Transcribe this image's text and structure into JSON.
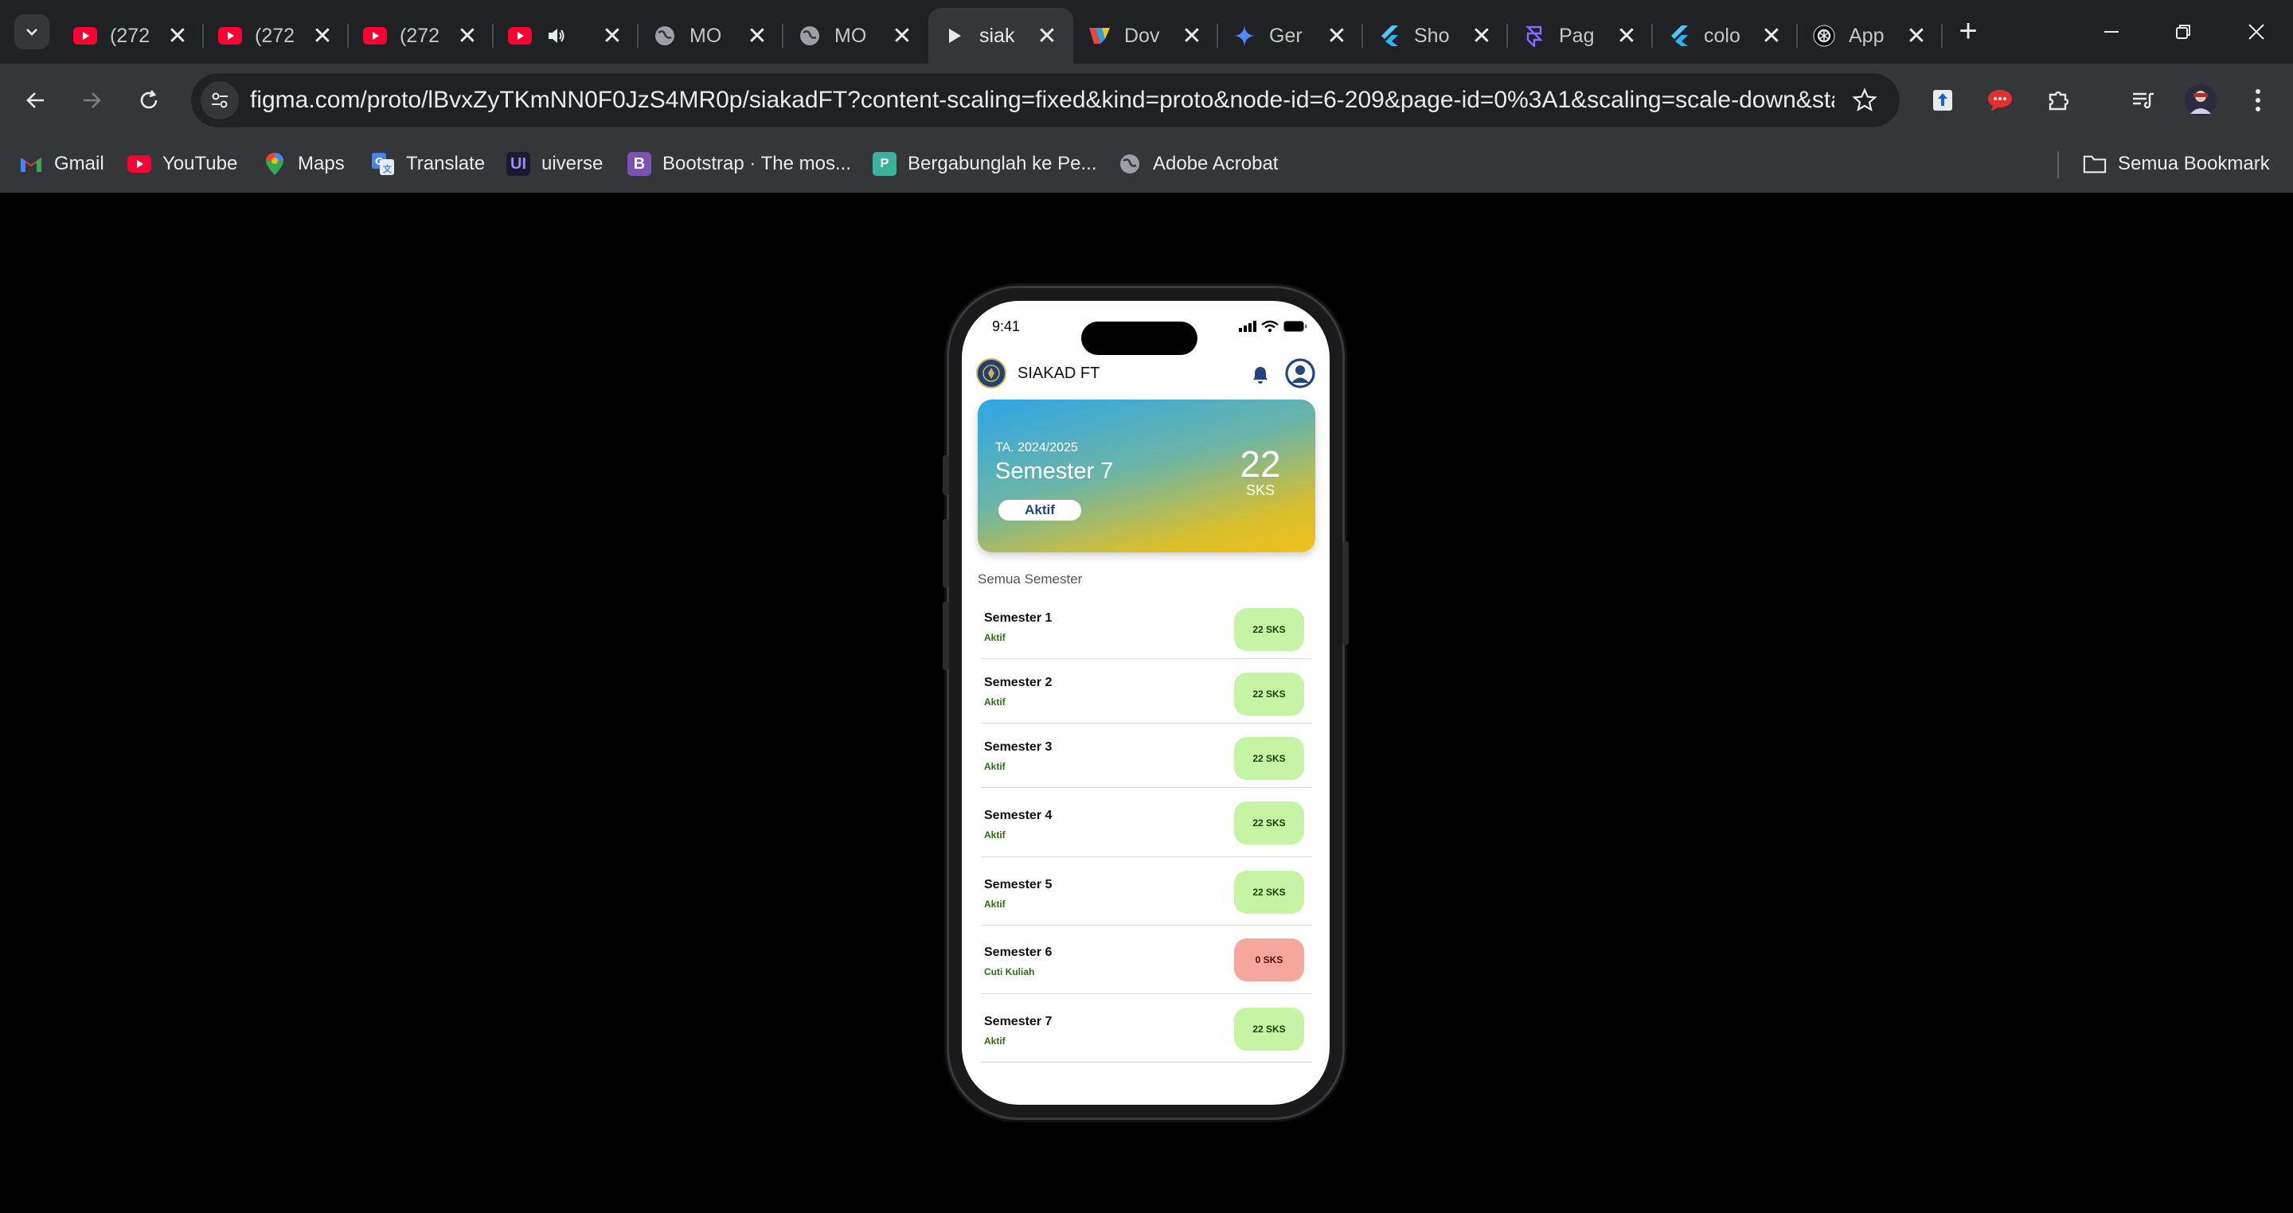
{
  "browser": {
    "tabs": [
      {
        "title": "(272",
        "icon": "youtube-icon"
      },
      {
        "title": "(272",
        "icon": "youtube-icon"
      },
      {
        "title": "(272",
        "icon": "youtube-icon"
      },
      {
        "title": "",
        "icon": "youtube-icon",
        "audio": true
      },
      {
        "title": "MO",
        "icon": "globe-icon"
      },
      {
        "title": "MO",
        "icon": "globe-icon"
      },
      {
        "title": "siak",
        "icon": "figma-play-icon",
        "active": true
      },
      {
        "title": "Dov",
        "icon": "color-logo-icon"
      },
      {
        "title": "Ger",
        "icon": "gemini-icon"
      },
      {
        "title": "Sho",
        "icon": "flutter-icon"
      },
      {
        "title": "Pag",
        "icon": "framer-icon"
      },
      {
        "title": "colo",
        "icon": "flutter-icon"
      },
      {
        "title": "App",
        "icon": "openai-icon"
      }
    ],
    "url": "figma.com/proto/lBvxZyTKmNN0F0JzS4MR0p/siakadFT?content-scaling=fixed&kind=proto&node-id=6-209&page-id=0%3A1&scaling=scale-down&starting-...",
    "bookmarks": [
      {
        "label": "Gmail",
        "icon": "gmail-icon"
      },
      {
        "label": "YouTube",
        "icon": "youtube-icon"
      },
      {
        "label": "Maps",
        "icon": "maps-icon"
      },
      {
        "label": "Translate",
        "icon": "translate-icon"
      },
      {
        "label": "uiverse",
        "icon": "uiverse-icon"
      },
      {
        "label": "Bootstrap · The mos...",
        "icon": "bootstrap-icon"
      },
      {
        "label": "Bergabunglah ke Pe...",
        "icon": "bookmark-site-icon"
      },
      {
        "label": "Adobe Acrobat",
        "icon": "globe-icon"
      }
    ],
    "all_bookmarks": "Semua Bookmark"
  },
  "phone": {
    "status_time": "9:41",
    "app_title": "SIAKAD FT",
    "current": {
      "year": "TA. 2024/2025",
      "semester": "Semester 7",
      "status": "Aktif",
      "sks": "22",
      "sks_unit": "SKS"
    },
    "section_title": "Semua Semester",
    "semesters": [
      {
        "name": "Semester 1",
        "status": "Aktif",
        "sks": "22 SKS"
      },
      {
        "name": "Semester 2",
        "status": "Aktif",
        "sks": "22 SKS"
      },
      {
        "name": "Semester 3",
        "status": "Aktif",
        "sks": "22 SKS"
      },
      {
        "name": "Semester 4",
        "status": "Aktif",
        "sks": "22 SKS"
      },
      {
        "name": "Semester 5",
        "status": "Aktif",
        "sks": "22 SKS"
      },
      {
        "name": "Semester 6",
        "status": "Cuti Kuliah",
        "sks": "0 SKS"
      },
      {
        "name": "Semester 7",
        "status": "Aktif",
        "sks": "22 SKS"
      }
    ]
  },
  "colors": {
    "active_pill": "#c5f5a4",
    "leave_pill": "#f6a79c",
    "brand_navy": "#23457f"
  }
}
